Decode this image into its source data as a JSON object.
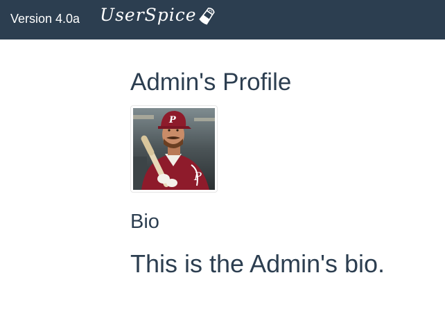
{
  "navbar": {
    "version_label": "Version 4.0a",
    "brand_text": "UserSpice",
    "brand_icon": "salt-shaker-icon",
    "background_color": "#2c3e50"
  },
  "profile": {
    "title": "Admin's Profile",
    "avatar_icon": "user-avatar-photo",
    "bio_heading": "Bio",
    "bio_text": "This is the Admin's bio."
  },
  "colors": {
    "text": "#2c3e50",
    "navbar": "#2c3e50",
    "jersey": "#8e1b2b"
  }
}
